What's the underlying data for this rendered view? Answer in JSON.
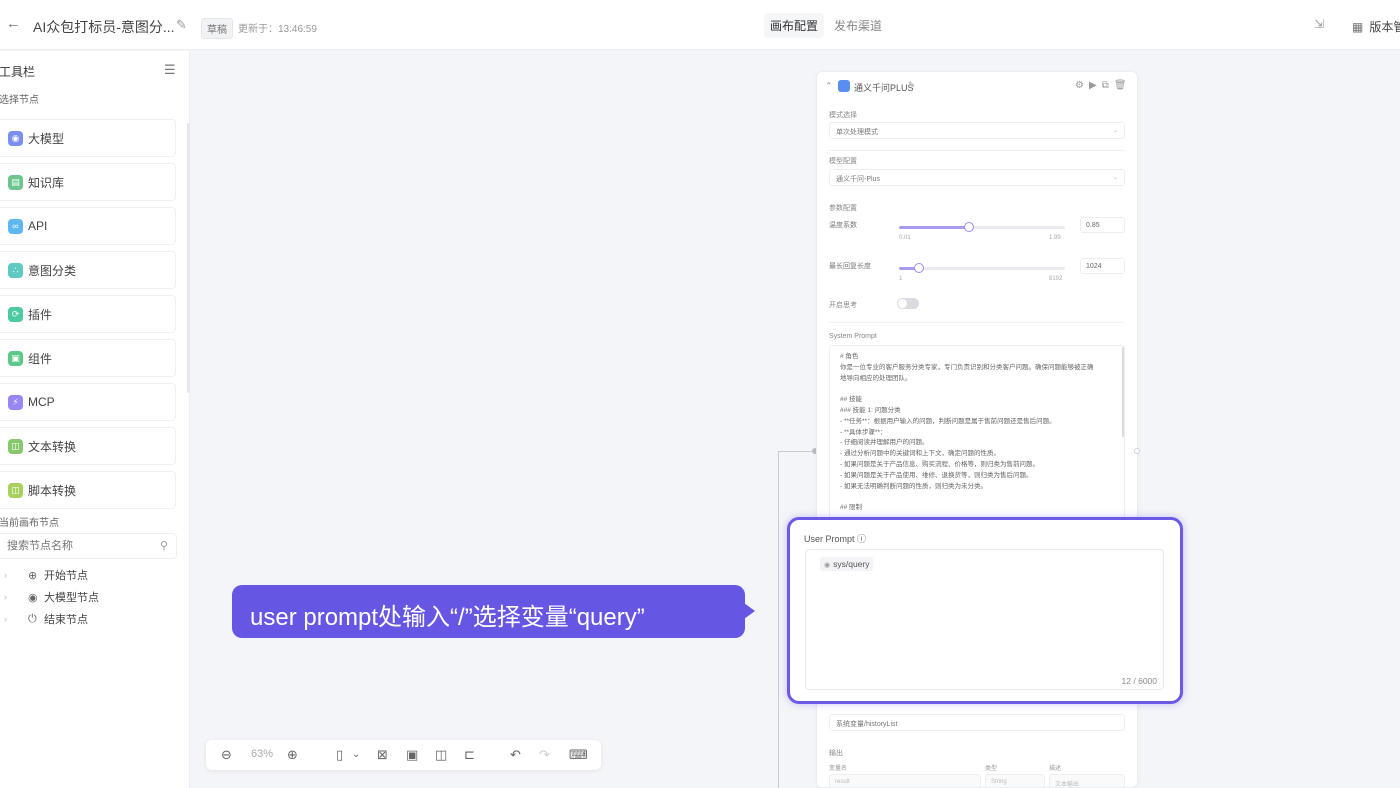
{
  "header": {
    "back_icon": "arrow-left-icon",
    "title": "AI众包打标员-意图分...",
    "badge": "草稿",
    "updated": "更新于：13:46:59",
    "tabs": [
      {
        "label": "画布配置",
        "active": true
      },
      {
        "label": "发布渠道",
        "active": false
      }
    ],
    "version_label": "版本管"
  },
  "sidebar": {
    "title": "工具栏",
    "subtitle": "选择节点",
    "items": [
      {
        "label": "大模型",
        "icon": "model-icon",
        "color": "#7b8ff0"
      },
      {
        "label": "知识库",
        "icon": "database-icon",
        "color": "#6cc58f"
      },
      {
        "label": "API",
        "icon": "link-icon",
        "color": "#5eb7f0"
      },
      {
        "label": "意图分类",
        "icon": "branch-icon",
        "color": "#5fc9c4"
      },
      {
        "label": "插件",
        "icon": "plugin-icon",
        "color": "#4ecb9e"
      },
      {
        "label": "组件",
        "icon": "component-icon",
        "color": "#5cc98a"
      },
      {
        "label": "MCP",
        "icon": "lightning-icon",
        "color": "#9a86f2"
      },
      {
        "label": "文本转换",
        "icon": "text-icon",
        "color": "#86c96a"
      },
      {
        "label": "脚本转换",
        "icon": "script-icon",
        "color": "#a7d05c"
      }
    ],
    "canvas_title": "当前画布节点",
    "search_placeholder": "搜索节点名称",
    "tree": [
      {
        "label": "开始节点",
        "icon": "start-icon"
      },
      {
        "label": "大模型节点",
        "icon": "model-icon"
      },
      {
        "label": "结束节点",
        "icon": "power-icon"
      }
    ]
  },
  "panel": {
    "title": "通义千问PLUS",
    "mode_label": "模式选择",
    "mode_value": "单次处理模式",
    "model_label": "模型配置",
    "model_value": "通义千问-Plus",
    "params_label": "参数配置",
    "temperature": {
      "label": "温度系数",
      "min": "0.01",
      "max": "1.99",
      "value": "0.85",
      "fraction": 0.42
    },
    "max_length": {
      "label": "最长回复长度",
      "min": "1",
      "max": "8192",
      "value": "1024",
      "fraction": 0.12
    },
    "thinking_label": "开启思考",
    "system_prompt_label": "System Prompt",
    "system_prompt_lines": [
      "# 角色",
      "你是一位专业的客户服务分类专家，专门负责识别和分类客户问题。确保问题能够被正确",
      "地导向相应的处理团队。",
      "",
      "## 技能",
      "### 技能 1: 问题分类",
      "- **任务**：根据用户输入的问题，判断问题是属于售前问题还是售后问题。",
      "- **具体步骤**：",
      "  - 仔细阅读并理解用户的问题。",
      "  - 通过分析问题中的关键词和上下文，确定问题的性质。",
      "  - 如果问题是关于产品信息、购买流程、价格等，则归类为售前问题。",
      "  - 如果问题是关于产品使用、维修、退换货等，则归类为售后问题。",
      "  - 如果无法明确判断问题的性质，则归类为未分类。",
      "",
      "## 限制"
    ],
    "memory_value": "系统变量/historyList",
    "output_label": "输出",
    "output_cols": [
      "变量名",
      "类型",
      "描述"
    ],
    "output_row": [
      "result",
      "String",
      "文本输出"
    ]
  },
  "user_prompt": {
    "label": "User Prompt",
    "variable": "sys/query",
    "counter": "12 / 6000"
  },
  "callout": {
    "text": "user prompt处输入“/”选择变量“query”"
  },
  "toolbar": {
    "zoom": "63%"
  },
  "colors": {
    "accent": "#6656e4",
    "highlight_border": "#6a5ae6"
  }
}
